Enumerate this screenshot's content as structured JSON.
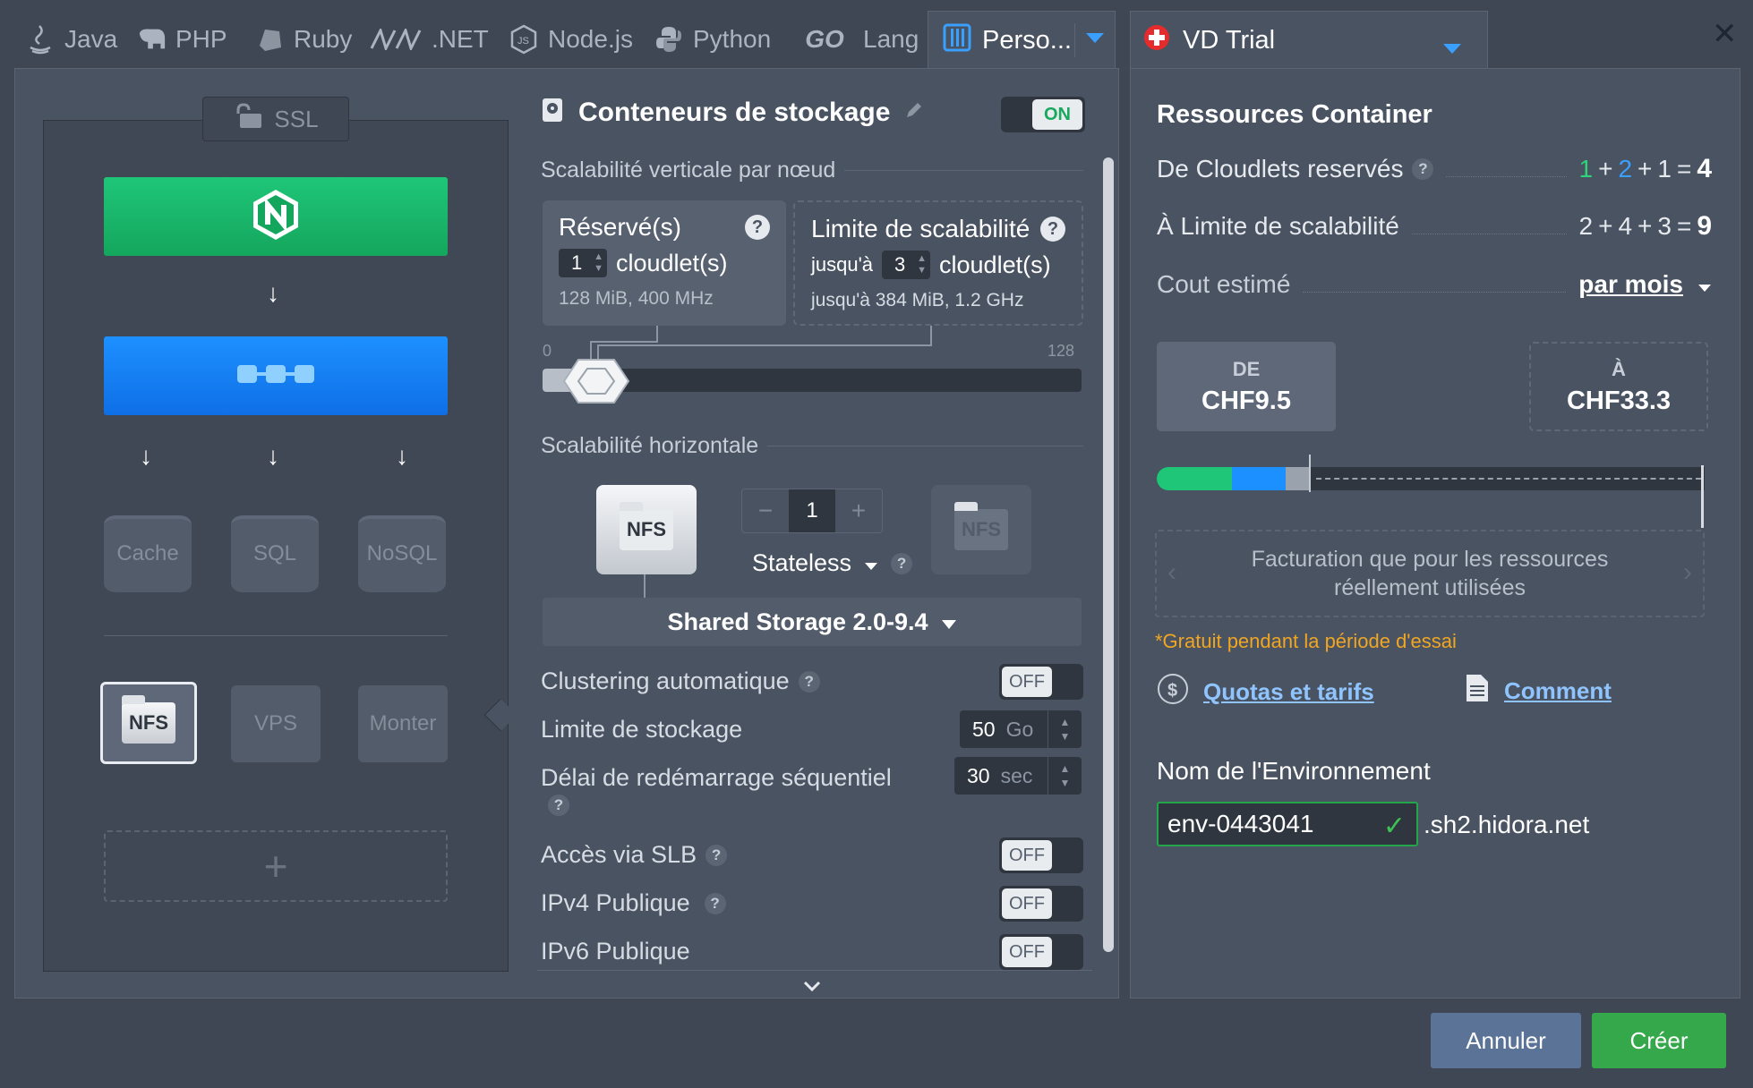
{
  "tabs": [
    {
      "label": "Java",
      "icon": "java-icon"
    },
    {
      "label": "PHP",
      "icon": "php-elephant-icon"
    },
    {
      "label": "Ruby",
      "icon": "ruby-icon"
    },
    {
      "label": ".NET",
      "icon": "dotnet-icon"
    },
    {
      "label": "Node.js",
      "icon": "nodejs-icon"
    },
    {
      "label": "Python",
      "icon": "python-icon"
    },
    {
      "label": "Lang",
      "icon": "go-icon"
    },
    {
      "label": "Perso...",
      "icon": "custom-icon"
    }
  ],
  "go_logo": "GO",
  "region": {
    "name": "VD Trial",
    "flag": "swiss-flag-icon"
  },
  "topology": {
    "ssl": "SSL",
    "dbs": [
      "Cache",
      "SQL",
      "NoSQL"
    ],
    "extras": {
      "nfs": "NFS",
      "vps": "VPS",
      "build": "Monter"
    },
    "add": "+"
  },
  "config": {
    "title": "Conteneurs de stockage",
    "on": "ON",
    "vertical_heading": "Scalabilité verticale par nœud",
    "reserved": {
      "title": "Réservé(s)",
      "value": "1",
      "unit": "cloudlet(s)",
      "sub": "128 MiB, 400 MHz"
    },
    "limit": {
      "title": "Limite de scalabilité",
      "prefix": "jusqu'à",
      "value": "3",
      "unit": "cloudlet(s)",
      "sub": "jusqu'à 384 MiB, 1.2 GHz"
    },
    "slider": {
      "min": "0",
      "max": "128",
      "value": 1
    },
    "horizontal_heading": "Scalabilité horizontale",
    "nodes": {
      "minus": "−",
      "count": "1",
      "plus": "+"
    },
    "mode": "Stateless",
    "nfs": "NFS",
    "storage": "Shared Storage 2.0-9.4",
    "auto_clustering": "Clustering automatique",
    "storage_limit": {
      "label": "Limite de stockage",
      "value": "50",
      "unit": "Go"
    },
    "restart_delay": {
      "label": "Délai de redémarrage séquentiel",
      "value": "30",
      "unit": "sec"
    },
    "slb": "Accès via SLB",
    "ipv4": "IPv4 Publique",
    "ipv6": "IPv6 Publique",
    "off": "OFF"
  },
  "resources": {
    "title": "Ressources Container",
    "reserved": {
      "label": "De Cloudlets reservés",
      "parts": [
        "1",
        "2",
        "1"
      ],
      "total": "4"
    },
    "limit": {
      "label": "À Limite de scalabilité",
      "parts": [
        "2",
        "4",
        "3"
      ],
      "total": "9"
    },
    "cost": {
      "label": "Cout estimé",
      "period": "par mois"
    },
    "from": {
      "label": "DE",
      "value": "CHF9.5"
    },
    "to": {
      "label": "À",
      "value": "CHF33.3"
    },
    "billing": "Facturation que pour les ressources réellement utilisées",
    "trial_note": "*Gratuit pendant la période d'essai",
    "quotas": "Quotas et tarifs",
    "how": "Comment",
    "env_label": "Nom de l'Environnement",
    "env_value": "env-0443041",
    "env_domain": ".sh2.hidora.net"
  },
  "buttons": {
    "cancel": "Annuler",
    "create": "Créer"
  },
  "colors": {
    "green": "#1fc678",
    "blue": "#1d90ff",
    "accent_link": "#8fc4ff",
    "orange": "#f0a623",
    "create": "#34a84a"
  }
}
